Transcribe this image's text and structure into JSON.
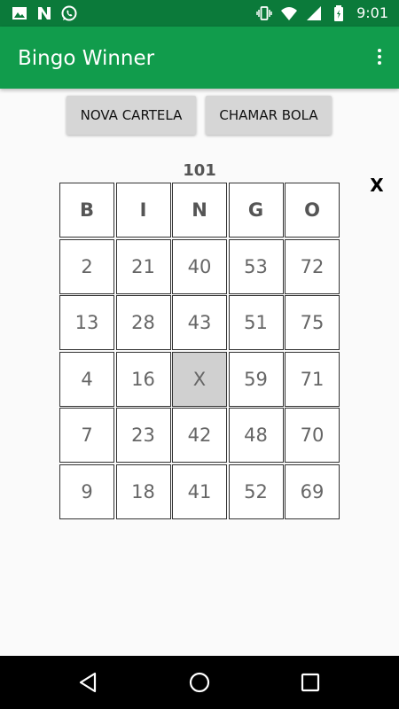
{
  "status_bar": {
    "time": "9:01",
    "icons": [
      "image-icon",
      "n-icon",
      "whatsapp-icon",
      "vibrate-icon",
      "wifi-icon",
      "signal-icon",
      "battery-icon"
    ]
  },
  "app_bar": {
    "title": "Bingo Winner",
    "menu_icon": "more-vert-icon"
  },
  "buttons": {
    "new_card": "NOVA CARTELA",
    "call_ball": "CHAMAR BOLA"
  },
  "card": {
    "number": "101",
    "close_label": "X",
    "headers": [
      "B",
      "I",
      "N",
      "G",
      "O"
    ],
    "rows": [
      [
        "2",
        "21",
        "40",
        "53",
        "72"
      ],
      [
        "13",
        "28",
        "43",
        "51",
        "75"
      ],
      [
        "4",
        "16",
        "X",
        "59",
        "71"
      ],
      [
        "7",
        "23",
        "42",
        "48",
        "70"
      ],
      [
        "9",
        "18",
        "41",
        "52",
        "69"
      ]
    ]
  },
  "colors": {
    "status_bar": "#0b7a3a",
    "app_bar": "#119c4c",
    "button_bg": "#d6d6d6",
    "marked_cell": "#d0d0d0"
  },
  "nav_bar": {
    "icons": [
      "back-icon",
      "home-icon",
      "recent-apps-icon"
    ]
  }
}
